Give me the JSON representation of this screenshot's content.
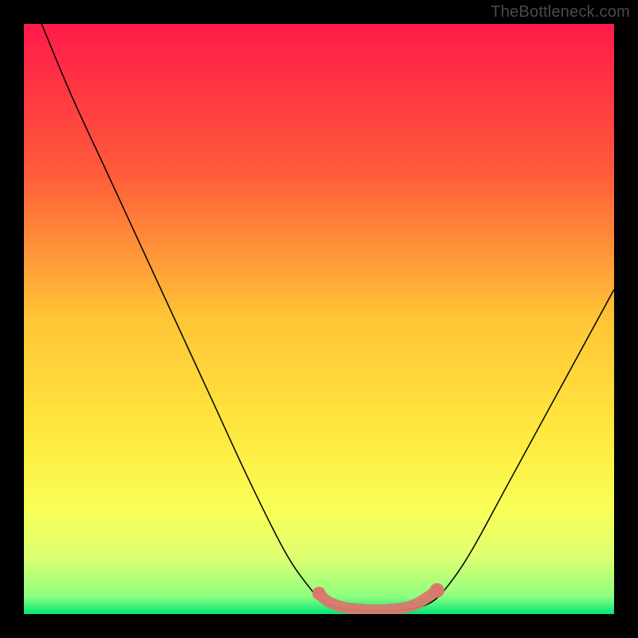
{
  "watermark": "TheBottleneck.com",
  "chart_data": {
    "type": "line",
    "title": "",
    "xlabel": "",
    "ylabel": "",
    "xlim": [
      0,
      100
    ],
    "ylim": [
      0,
      100
    ],
    "background_gradient": {
      "stops": [
        {
          "offset": 0,
          "color": "#ff1a4a"
        },
        {
          "offset": 25,
          "color": "#ff5a3a"
        },
        {
          "offset": 50,
          "color": "#ffc536"
        },
        {
          "offset": 70,
          "color": "#ffe93f"
        },
        {
          "offset": 82,
          "color": "#f8ff55"
        },
        {
          "offset": 90,
          "color": "#e0ff70"
        },
        {
          "offset": 97,
          "color": "#90ff80"
        },
        {
          "offset": 100,
          "color": "#00e676"
        }
      ]
    },
    "series": [
      {
        "name": "bottleneck-curve",
        "color": "#000000",
        "width": 1.5,
        "points": [
          {
            "x": 3,
            "y": 100
          },
          {
            "x": 8,
            "y": 88
          },
          {
            "x": 14,
            "y": 75
          },
          {
            "x": 20,
            "y": 62
          },
          {
            "x": 26,
            "y": 49
          },
          {
            "x": 32,
            "y": 36
          },
          {
            "x": 38,
            "y": 23
          },
          {
            "x": 44,
            "y": 11
          },
          {
            "x": 48,
            "y": 5
          },
          {
            "x": 51,
            "y": 2
          },
          {
            "x": 55,
            "y": 0.8
          },
          {
            "x": 60,
            "y": 0.6
          },
          {
            "x": 65,
            "y": 0.8
          },
          {
            "x": 69,
            "y": 2
          },
          {
            "x": 72,
            "y": 5
          },
          {
            "x": 76,
            "y": 11
          },
          {
            "x": 82,
            "y": 22
          },
          {
            "x": 88,
            "y": 33
          },
          {
            "x": 94,
            "y": 44
          },
          {
            "x": 100,
            "y": 55
          }
        ]
      }
    ],
    "highlight": {
      "name": "optimal-range",
      "color": "#d9786e",
      "points": [
        {
          "x": 50,
          "y": 3.5,
          "r": 2.0
        },
        {
          "x": 51,
          "y": 2.5,
          "r": 2.0
        },
        {
          "x": 52,
          "y": 1.9,
          "r": 2.0
        },
        {
          "x": 53,
          "y": 1.5,
          "r": 2.0
        },
        {
          "x": 54,
          "y": 1.2,
          "r": 2.0
        },
        {
          "x": 55,
          "y": 1.0,
          "r": 2.0
        },
        {
          "x": 56,
          "y": 0.9,
          "r": 2.0
        },
        {
          "x": 57,
          "y": 0.8,
          "r": 2.0
        },
        {
          "x": 58,
          "y": 0.7,
          "r": 2.0
        },
        {
          "x": 59,
          "y": 0.7,
          "r": 2.0
        },
        {
          "x": 60,
          "y": 0.7,
          "r": 2.0
        },
        {
          "x": 61,
          "y": 0.7,
          "r": 2.0
        },
        {
          "x": 62,
          "y": 0.8,
          "r": 2.0
        },
        {
          "x": 63,
          "y": 0.9,
          "r": 2.0
        },
        {
          "x": 64,
          "y": 1.0,
          "r": 2.0
        },
        {
          "x": 65,
          "y": 1.2,
          "r": 2.0
        },
        {
          "x": 66,
          "y": 1.5,
          "r": 2.0
        },
        {
          "x": 67,
          "y": 2.0,
          "r": 2.0
        },
        {
          "x": 68,
          "y": 2.6,
          "r": 2.0
        },
        {
          "x": 70,
          "y": 4.0,
          "r": 2.2
        }
      ]
    }
  }
}
